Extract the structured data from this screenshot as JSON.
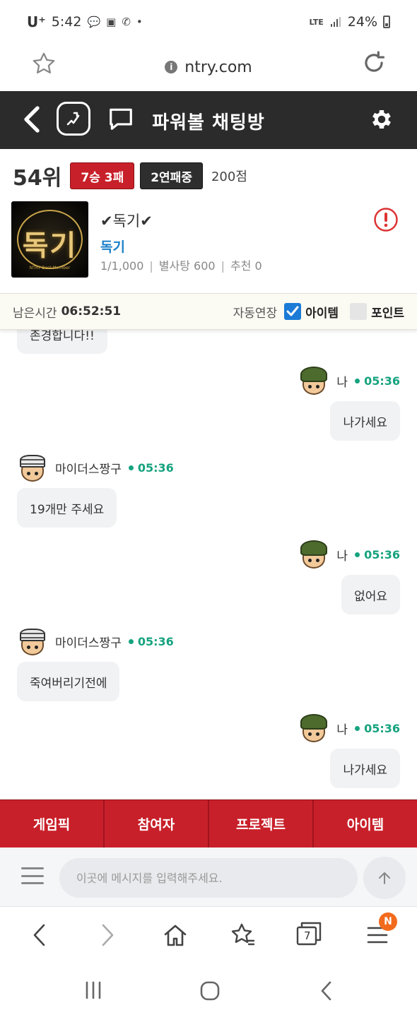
{
  "status_bar": {
    "carrier": "U⁺",
    "time": "5:42",
    "icons": [
      "talk-icon",
      "image-icon",
      "wifi-call-icon",
      "dot-icon"
    ],
    "network": "LTE",
    "battery": "24%"
  },
  "browser": {
    "url": "ntry.com",
    "tab_count": "7",
    "menu_badge": "N"
  },
  "header": {
    "title": "파워볼 채팅방"
  },
  "profile": {
    "rank": "54위",
    "record": "7승 3패",
    "streak": "2연패중",
    "points": "200점",
    "thumbnail_text": "독기",
    "thumbnail_subtext": "NTRY Best Member",
    "name": "✔독기✔",
    "link": "독기",
    "stat_count": "1/1,000",
    "stat_candy": "별사탕 600",
    "stat_recommend": "추천 0"
  },
  "timer": {
    "label": "남은시간",
    "value": "06:52:51",
    "auto_extend": "자동연장",
    "item_label": "아이템",
    "item_checked": true,
    "point_label": "포인트",
    "point_checked": false
  },
  "chat": {
    "partial_message": "존경합니다!!",
    "messages": [
      {
        "sender": "나",
        "time": "05:36",
        "text": "나가세요",
        "mine": true
      },
      {
        "sender": "마이더스짱구",
        "time": "05:36",
        "text": "19개만 주세요",
        "mine": false
      },
      {
        "sender": "나",
        "time": "05:36",
        "text": "없어요",
        "mine": true
      },
      {
        "sender": "마이더스짱구",
        "time": "05:36",
        "text": "죽여버리기전에",
        "mine": false
      },
      {
        "sender": "나",
        "time": "05:36",
        "text": "나가세요",
        "mine": true
      }
    ]
  },
  "tabs": [
    "게임픽",
    "참여자",
    "프로젝트",
    "아이템"
  ],
  "input": {
    "placeholder": "이곳에 메시지를 입력해주세요."
  },
  "colors": {
    "accent_red": "#c8202a",
    "header_dark": "#2b2b2b",
    "time_green": "#16a37f",
    "link_blue": "#1a7fc8",
    "badge_orange": "#f26b1d"
  }
}
